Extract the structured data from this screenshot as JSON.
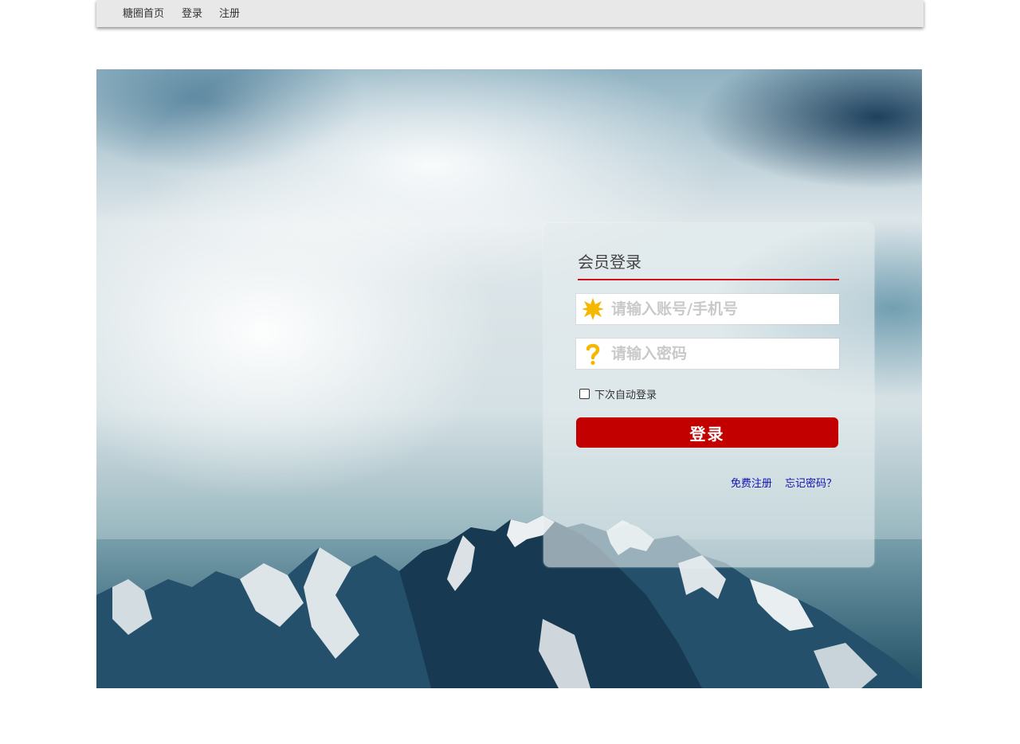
{
  "nav": {
    "home": "糖圈首页",
    "login": "登录",
    "register": "注册"
  },
  "login_panel": {
    "title": "会员登录",
    "username_placeholder": "请输入账号/手机号",
    "username_icon": "star-icon",
    "password_placeholder": "请输入密码",
    "password_icon": "question-mark-icon",
    "remember_label": "下次自动登录",
    "remember_checked": false,
    "submit_label": "登录",
    "free_register_link": "免费注册",
    "forgot_password_link": "忘记密码？"
  },
  "colors": {
    "accent_red": "#c30000",
    "rule_red": "#d0101a",
    "link_blue": "#1010b0",
    "icon_yellow": "#f5b800"
  }
}
